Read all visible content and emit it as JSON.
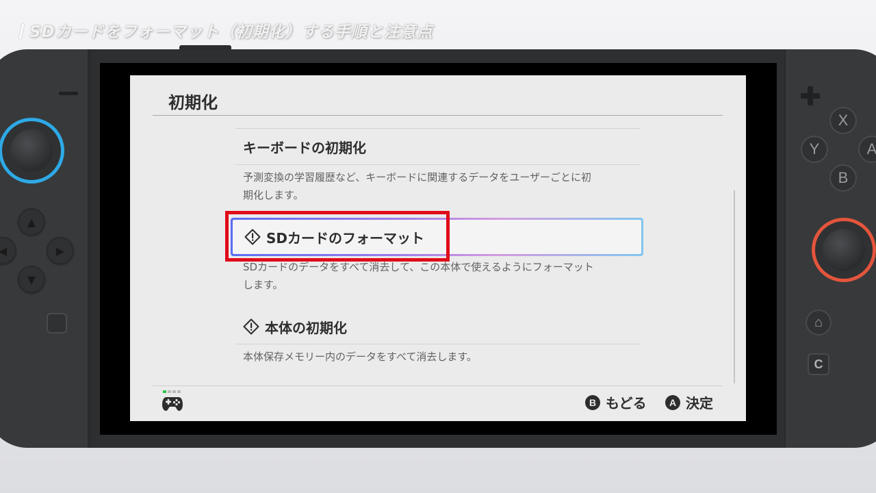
{
  "video": {
    "title": "SDカードをフォーマット（初期化）する手順と注意点"
  },
  "console": {
    "left_buttons": {
      "up": "▲",
      "down": "▼",
      "left": "◀",
      "right": "▶"
    },
    "right_buttons": {
      "x": "X",
      "y": "Y",
      "a": "A",
      "b": "B",
      "home": "⌂",
      "capture": "C"
    },
    "colors": {
      "left_stick_ring": "#2ea9e6",
      "right_stick_ring": "#e3553c"
    }
  },
  "screen": {
    "title": "初期化",
    "items": [
      {
        "label": "キーボードの初期化",
        "description": "予測変換の学習履歴など、キーボードに関連するデータをユーザーごとに初期化します。",
        "desc_line1": "予測変換の学習履歴など、キーボードに関連するデータをユーザーごとに初",
        "desc_line2": "期化します。"
      },
      {
        "label": "SDカードのフォーマット",
        "warning": true,
        "selected": true,
        "desc_line1": "SDカードのデータをすべて消去して、この本体で使えるようにフォーマット",
        "desc_line2": "します。"
      },
      {
        "label": "本体の初期化",
        "warning": true,
        "desc_line1": "本体保存メモリー内のデータをすべて消去します。"
      }
    ],
    "footer": {
      "back_button": "B",
      "back_label": "もどる",
      "confirm_button": "A",
      "confirm_label": "決定"
    },
    "colors": {
      "highlight_red": "#e00b19",
      "player_indicator": "#2ec64b"
    }
  }
}
